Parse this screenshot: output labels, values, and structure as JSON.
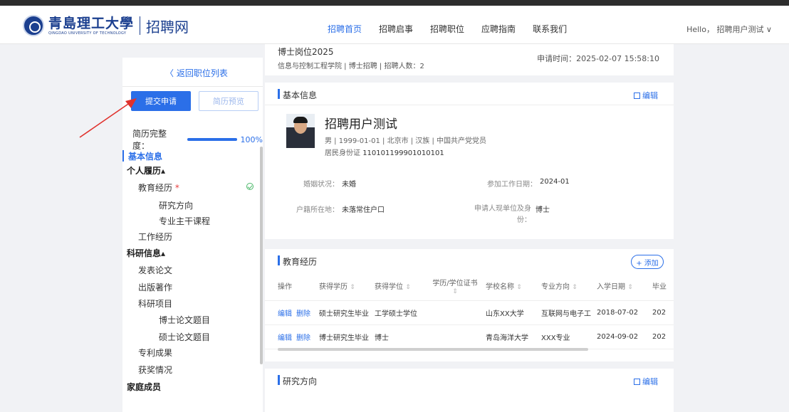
{
  "header": {
    "logo_cn": "青島理工大學",
    "logo_en": "QINGDAO UNIVERSITY OF TECHNOLOGY",
    "site_name": "招聘网",
    "nav": [
      "招聘首页",
      "招聘启事",
      "招聘职位",
      "应聘指南",
      "联系我们"
    ],
    "active_nav": "招聘首页",
    "user_greeting": "Hello， 招聘用户测试 ∨"
  },
  "sidebar": {
    "back_link": "〈 返回职位列表",
    "submit_button": "提交申请",
    "preview_button": "简历预览",
    "completeness_label": "简历完整度：",
    "completeness_value": "100%",
    "completeness_fraction": 1.0,
    "menu": {
      "basic_info": "基本信息",
      "personal_history": "个人履历",
      "education": "教育经历",
      "research_direction": "研究方向",
      "major_courses": "专业主干课程",
      "work_experience": "工作经历",
      "research_info": "科研信息",
      "papers": "发表论文",
      "publications": "出版著作",
      "projects": "科研项目",
      "phd_thesis": "博士论文题目",
      "master_thesis": "硕士论文题目",
      "patents": "专利成果",
      "awards": "获奖情况",
      "family": "家庭成员"
    }
  },
  "job": {
    "title": "博士岗位2025",
    "meta": "信息与控制工程学院 | 博士招聘 | 招聘人数：2",
    "apply_time_label": "申请时间：",
    "apply_time": "2025-02-07 15:58:10"
  },
  "basic_info": {
    "section_title": "基本信息",
    "edit_label": "编辑",
    "name": "招聘用户测试",
    "meta": "男  |  1999-01-01  |  北京市  |  汉族  |  中国共产党党员",
    "id_label": "居民身份证",
    "id_number": "110101199901010101",
    "marital_label": "婚姻状况：",
    "marital_value": "未婚",
    "work_date_label": "参加工作日期：",
    "work_date_value": "2024-01",
    "hukou_label": "户籍所在地：",
    "hukou_value": "未落常住户口",
    "identity_label": "申请人现单位及身份：",
    "identity_value": "博士"
  },
  "education": {
    "section_title": "教育经历",
    "add_label": "+ 添加",
    "headers": [
      "操作",
      "获得学历",
      "获得学位",
      "学历/学位证书",
      "学校名称",
      "专业方向",
      "入学日期",
      "毕业"
    ],
    "edit_action": "编辑",
    "delete_action": "删除",
    "rows": [
      [
        "硕士研究生毕业",
        "工学硕士学位",
        "",
        "山东XX大学",
        "互联网与电子工",
        "2018-07-02",
        "202"
      ],
      [
        "博士研究生毕业",
        "博士",
        "",
        "青岛海洋大学",
        "XXX专业",
        "2024-09-02",
        "202"
      ]
    ]
  },
  "research": {
    "section_title": "研究方向",
    "edit_label": "编辑"
  }
}
